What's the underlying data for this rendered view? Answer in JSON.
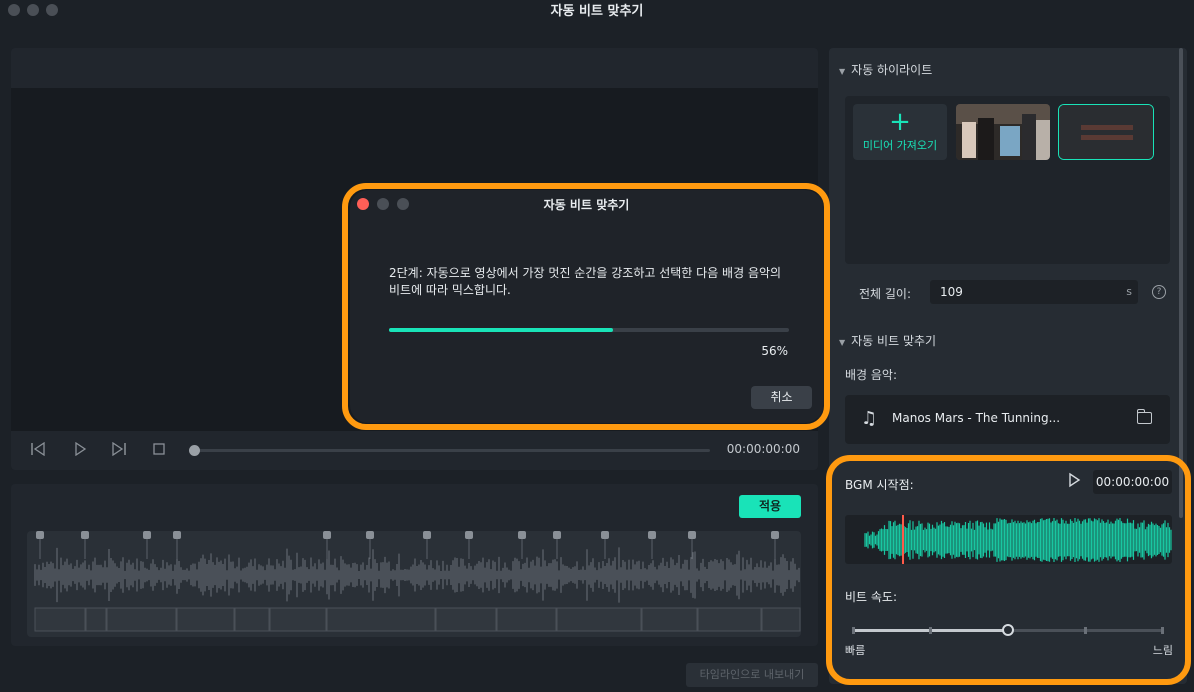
{
  "window": {
    "title": "자동 비트 맞추기"
  },
  "player": {
    "time": "00:00:00:00",
    "progress": 0
  },
  "waveform_panel": {
    "apply_label": "적용",
    "export_label": "타임라인으로 내보내기"
  },
  "highlight": {
    "section_title": "자동 하이라이트",
    "import_label": "미디어 가져오기",
    "total_length_label": "전체 길이:",
    "total_length_value": "109",
    "total_length_unit": "s"
  },
  "beat_sync": {
    "section_title": "자동 비트 맞추기",
    "bgm_label": "배경 음악:",
    "music_name": "Manos Mars - The Tunning...",
    "bgm_start_label": "BGM 시작점:",
    "bgm_start_time": "00:00:00:00",
    "speed_label": "비트 속도:",
    "speed_fast": "빠름",
    "speed_slow": "느림",
    "speed_level": 0.5
  },
  "modal": {
    "title": "자동 비트 맞추기",
    "message": "2단계: 자동으로 영상에서 가장 멋진 순간을 강조하고 선택한 다음 배경 음악의 비트에 따라 믹스합니다.",
    "progress_percent": 56,
    "progress_label": "56%",
    "cancel_label": "취소"
  },
  "colors": {
    "accent": "#19e3b8",
    "highlight": "#ff9a10"
  }
}
